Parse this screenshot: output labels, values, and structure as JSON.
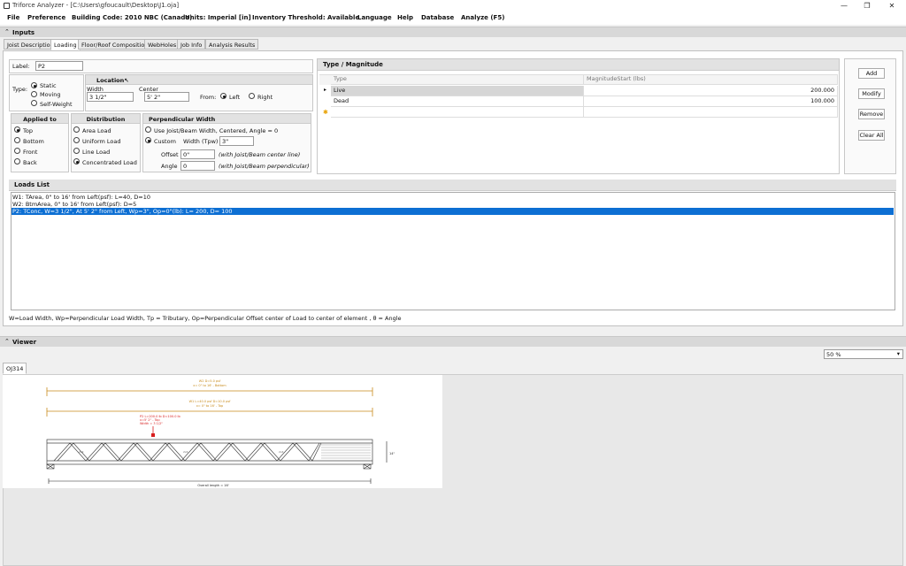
{
  "window": {
    "title": "Triforce Analyzer  - [C:\\Users\\gfoucault\\Desktop\\J1.oja]",
    "min": "—",
    "max": "❐",
    "close": "✕"
  },
  "menu": [
    "File",
    "Preference",
    "Building Code:  2010 NBC (Canada)",
    "Units:  Imperial [in]",
    "Inventory Threshold:  Available",
    "Language",
    "Help",
    "Database",
    "Analyze (F5)"
  ],
  "inputs_header": "Inputs",
  "tabs": [
    "Joist Description",
    "Loading",
    "Floor/Roof Composition",
    "WebHoles",
    "Job Info",
    "Analysis Results"
  ],
  "active_tab": "Loading",
  "form": {
    "label_text": "Label:",
    "label_value": "P2",
    "type_text": "Type:",
    "types": [
      "Static",
      "Moving",
      "Self-Weight"
    ],
    "type_selected": "Static",
    "location_header": "Location",
    "width_label": "Width",
    "width_value": "3 1/2\"",
    "center_label": "Center",
    "center_value": "5' 2\"",
    "from_label": "From:",
    "from_options": [
      "Left",
      "Right"
    ],
    "from_selected": "Left",
    "applied_header": "Applied to",
    "applied_options": [
      "Top",
      "Bottom",
      "Front",
      "Back"
    ],
    "applied_selected": "Top",
    "distribution_header": "Distribution",
    "distribution_options": [
      "Area Load",
      "Uniform Load",
      "Line Load",
      "Concentrated Load"
    ],
    "distribution_selected": "Concentrated Load",
    "perp_header": "Perpendicular Width",
    "perp_option1": "Use Joist/Beam Width, Centered, Angle = 0",
    "perp_option2": "Custom",
    "perp_selected": "Custom",
    "tpw_label": "Width (Tpw)",
    "tpw_value": "3\"",
    "offset_label": "Offset",
    "offset_value": "0\"",
    "offset_note": "(with Joist/Beam center line)",
    "angle_label": "Angle",
    "angle_value": "0",
    "angle_note": "(with Joist/Beam perpendicular)"
  },
  "magnitude": {
    "header": "Type / Magnitude",
    "col_type": "Type",
    "col_mag": "MagnitudeStart (lbs)",
    "rows": [
      {
        "type": "Live",
        "value": "200.000"
      },
      {
        "type": "Dead",
        "value": "100.000"
      }
    ],
    "row_marker": "▸",
    "new_marker": "✱"
  },
  "buttons": {
    "add": "Add",
    "modify": "Modify",
    "remove": "Remove",
    "clear": "Clear All"
  },
  "loads_list": {
    "header": "Loads List",
    "items": [
      "W1: TArea, 0\" to 16' from Left(psf): L=40, D=10",
      "W2: BtmArea, 0\" to 16' from Left(psf): D=5",
      "P2: TConc, W=3 1/2\", At 5' 2\" from Left, Wp=3\", Op=0\"(lb): L= 200, D= 100"
    ],
    "selected_index": 2
  },
  "legend": "W=Load Width, Wp=Perpendicular Load Width, Tp = Tributary, Op=Perpendicular Offset center of Load to center of element , θ = Angle",
  "viewer": {
    "header": "Viewer",
    "zoom": "50 %",
    "tab": "OJ314",
    "ann_w2_1": "W2 D=5.0 psf",
    "ann_w2_2": "x= 0\" to 16' - Bottom",
    "ann_w1_1": "W1 L=40.0 psf D=10.0 psf",
    "ann_w1_2": "x= 0\" to 16' - Top",
    "ann_p2_1": "P2 L=200.0 lb D=100.0 lb",
    "ann_p2_2": "x=5' 2\" - Top",
    "ann_p2_3": "Width = 3 1/2\"",
    "depth": "14\"",
    "overall": "Overall length = 16'",
    "web_label": "2x4"
  },
  "colors": {
    "selection": "#0d6fd3",
    "dim_orange": "#c88a1a",
    "point_red": "#d81e1e"
  }
}
